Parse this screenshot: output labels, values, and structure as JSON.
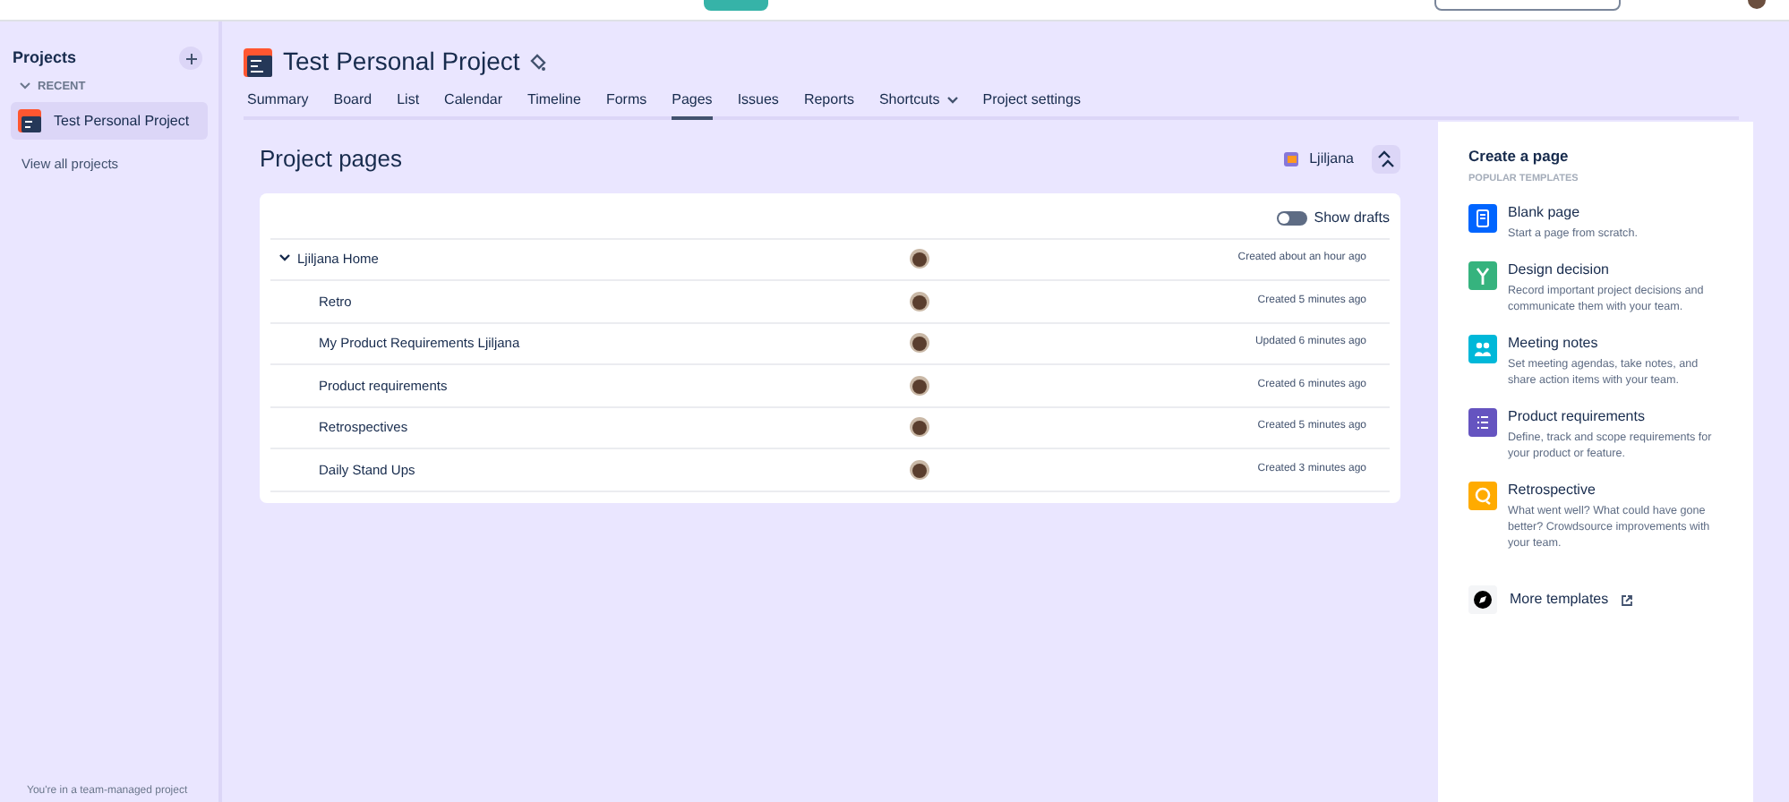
{
  "sidebar": {
    "title": "Projects",
    "section": "RECENT",
    "items": [
      {
        "label": "Test Personal Project",
        "selected": true
      }
    ],
    "view_all": "View all projects",
    "footer": "You're in a team-managed project"
  },
  "project": {
    "title": "Test Personal Project"
  },
  "tabs": [
    {
      "label": "Summary",
      "selected": false,
      "kind": "link"
    },
    {
      "label": "Board",
      "selected": false,
      "kind": "link"
    },
    {
      "label": "List",
      "selected": false,
      "kind": "link"
    },
    {
      "label": "Calendar",
      "selected": false,
      "kind": "link"
    },
    {
      "label": "Timeline",
      "selected": false,
      "kind": "link"
    },
    {
      "label": "Forms",
      "selected": false,
      "kind": "link"
    },
    {
      "label": "Pages",
      "selected": true,
      "kind": "link"
    },
    {
      "label": "Issues",
      "selected": false,
      "kind": "link"
    },
    {
      "label": "Reports",
      "selected": false,
      "kind": "link"
    },
    {
      "label": "Shortcuts",
      "selected": false,
      "kind": "menu"
    },
    {
      "label": "Project settings",
      "selected": false,
      "kind": "link"
    }
  ],
  "page": {
    "title": "Project pages",
    "owner": "Ljiljana"
  },
  "table": {
    "show_drafts": {
      "label": "Show drafts",
      "on": false
    },
    "rows": [
      {
        "title": "Ljiljana Home",
        "status": "Created about an hour ago",
        "expanded": true,
        "children": [
          {
            "title": "Retro",
            "status": "Created 5 minutes ago"
          },
          {
            "title": "My Product Requirements Ljiljana",
            "status": "Updated 6 minutes ago"
          },
          {
            "title": "Product requirements",
            "status": "Created 6 minutes ago"
          },
          {
            "title": "Retrospectives",
            "status": "Created 5 minutes ago"
          },
          {
            "title": "Daily Stand Ups",
            "status": "Created 3 minutes ago"
          }
        ]
      }
    ]
  },
  "templates": {
    "title": "Create a page",
    "subtitle": "POPULAR TEMPLATES",
    "items": [
      {
        "name": "Blank page",
        "description": "Start a page from scratch.",
        "color": "#0065ff",
        "kind": "blank"
      },
      {
        "name": "Design decision",
        "description": "Record important project decisions and communicate them with your team.",
        "color": "#36b37e",
        "kind": "decision"
      },
      {
        "name": "Meeting notes",
        "description": "Set meeting agendas, take notes, and share action items with your team.",
        "color": "#00b8d9",
        "kind": "meeting"
      },
      {
        "name": "Product requirements",
        "description": "Define, track and scope requirements for your product or feature.",
        "color": "#6554c0",
        "kind": "requirements"
      },
      {
        "name": "Retrospective",
        "description": "What went well? What could have gone better? Crowdsource improvements with your team.",
        "color": "#ffab00",
        "kind": "retro"
      }
    ],
    "more": "More templates"
  }
}
